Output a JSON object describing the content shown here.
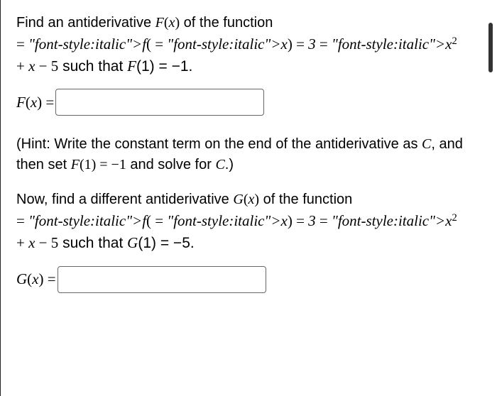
{
  "q1": {
    "line1": "Find an antiderivative F(x) of the function",
    "line2_prefix": "f(x) = 3x",
    "line2_exp": "2",
    "line2_rest": " + x − 5 such that F(1) = −1.",
    "lhs": "F(x) ="
  },
  "hint": "(Hint: Write the constant term on the end of the antiderivative as C, and then set F(1) = −1 and solve for C.)",
  "q2": {
    "line1": "Now, find a different antiderivative G(x) of the function",
    "line2_prefix": "f(x) = 3x",
    "line2_exp": "2",
    "line2_rest": " + x − 5 such that G(1) = −5.",
    "lhs": "G(x) ="
  },
  "inputs": {
    "f_value": "",
    "g_value": ""
  }
}
